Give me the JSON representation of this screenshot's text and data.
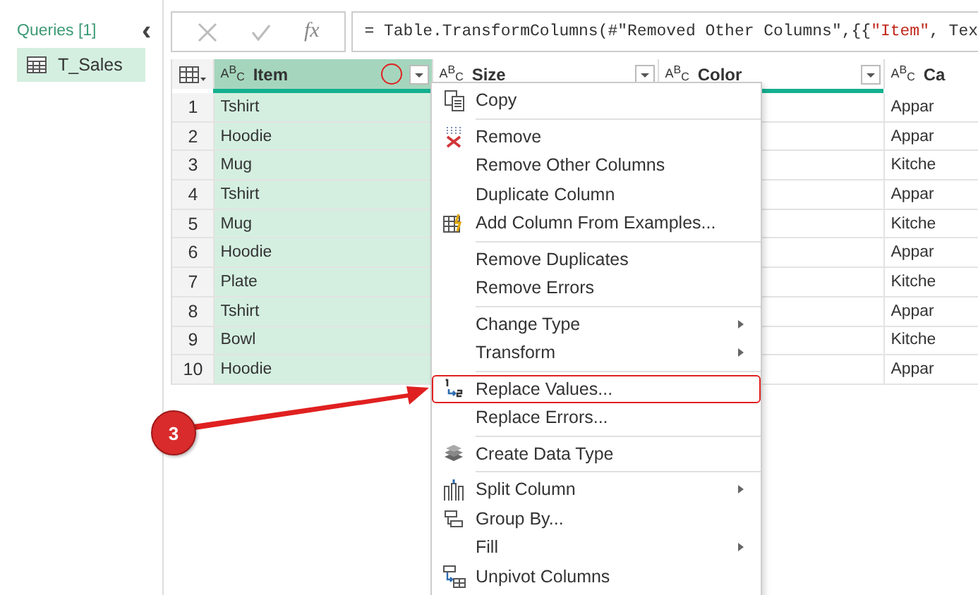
{
  "queries_pane": {
    "title": "Queries [1]",
    "collapse_glyph": "‹",
    "items": [
      {
        "label": "T_Sales",
        "selected": true
      }
    ]
  },
  "formula_bar": {
    "fx": "fx",
    "formula": [
      {
        "kind": "code",
        "text": "= Table.TransformColumns(#\"Removed Other Columns\",{{"
      },
      {
        "kind": "string",
        "text": "\"Item\""
      },
      {
        "kind": "code",
        "text": ", Tex"
      }
    ]
  },
  "table": {
    "columns": [
      {
        "type_label": "A$^{B}$$_{C}$",
        "name": "Item",
        "selected": true
      },
      {
        "type_label": "A$^{B}$$_{C}$",
        "name": "Size",
        "selected": false
      },
      {
        "type_label": "A$^{B}$$_{C}$",
        "name": "Color",
        "selected": false
      },
      {
        "type_label": "A$^{B}$$_{C}$",
        "name": "Ca",
        "selected": false
      }
    ],
    "rows": [
      {
        "number": "1",
        "item": "Tshirt",
        "column_4": "Appar"
      },
      {
        "number": "2",
        "item": "Hoodie",
        "column_4": "Appar"
      },
      {
        "number": "3",
        "item": "Mug",
        "column_4": "Kitche"
      },
      {
        "number": "4",
        "item": "Tshirt",
        "column_4": "Appar"
      },
      {
        "number": "5",
        "item": "Mug",
        "column_4": "Kitche"
      },
      {
        "number": "6",
        "item": "Hoodie",
        "column_4": "Appar"
      },
      {
        "number": "7",
        "item": "Plate",
        "column_4": "Kitche"
      },
      {
        "number": "8",
        "item": "Tshirt",
        "column_4": "Appar"
      },
      {
        "number": "9",
        "item": "Bowl",
        "column_4": "Kitche"
      },
      {
        "number": "10",
        "item": "Hoodie",
        "column_4": "Appar"
      }
    ]
  },
  "context_menu": {
    "items": [
      {
        "kind": "item",
        "label": "Copy",
        "submenu": false,
        "highlighted": false
      },
      {
        "kind": "divider"
      },
      {
        "kind": "item",
        "label": "Remove",
        "submenu": false,
        "highlighted": false
      },
      {
        "kind": "item",
        "label": "Remove Other Columns",
        "submenu": false,
        "highlighted": false
      },
      {
        "kind": "item",
        "label": "Duplicate Column",
        "submenu": false,
        "highlighted": false
      },
      {
        "kind": "item",
        "label": "Add Column From Examples...",
        "submenu": false,
        "highlighted": false
      },
      {
        "kind": "divider"
      },
      {
        "kind": "item",
        "label": "Remove Duplicates",
        "submenu": false,
        "highlighted": false
      },
      {
        "kind": "item",
        "label": "Remove Errors",
        "submenu": false,
        "highlighted": false
      },
      {
        "kind": "divider"
      },
      {
        "kind": "item",
        "label": "Change Type",
        "submenu": true,
        "highlighted": false
      },
      {
        "kind": "item",
        "label": "Transform",
        "submenu": true,
        "highlighted": false
      },
      {
        "kind": "divider"
      },
      {
        "kind": "item",
        "label": "Replace Values...",
        "submenu": false,
        "highlighted": true
      },
      {
        "kind": "item",
        "label": "Replace Errors...",
        "submenu": false,
        "highlighted": false
      },
      {
        "kind": "divider"
      },
      {
        "kind": "item",
        "label": "Create Data Type",
        "submenu": false,
        "highlighted": false
      },
      {
        "kind": "divider"
      },
      {
        "kind": "item",
        "label": "Split Column",
        "submenu": true,
        "highlighted": false
      },
      {
        "kind": "item",
        "label": "Group By...",
        "submenu": false,
        "highlighted": false
      },
      {
        "kind": "item",
        "label": "Fill",
        "submenu": true,
        "highlighted": false
      },
      {
        "kind": "item",
        "label": "Unpivot Columns",
        "submenu": false,
        "highlighted": false
      }
    ]
  },
  "annotation": {
    "badge": "3",
    "header_circle": true
  }
}
